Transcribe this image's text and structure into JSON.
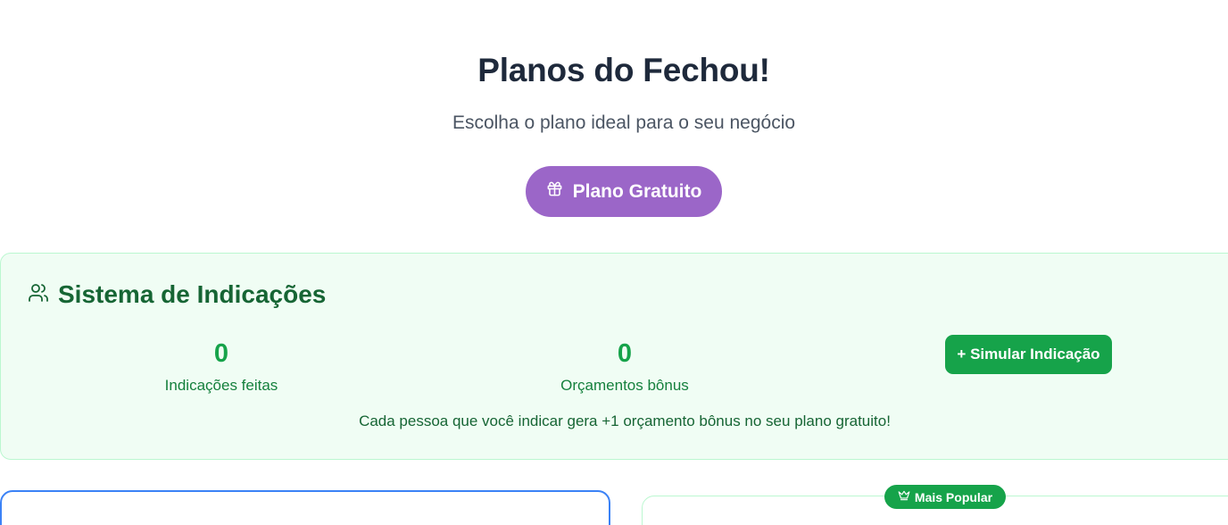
{
  "header": {
    "title": "Planos do Fechou!",
    "subtitle": "Escolha o plano ideal para o seu negócio",
    "plan_pill": {
      "label": "Plano Gratuito",
      "icon": "gift-icon",
      "color": "#9b66c8"
    }
  },
  "referral": {
    "title": "Sistema de Indicações",
    "icon": "users-icon",
    "stats": [
      {
        "value": "0",
        "label": "Indicações feitas"
      },
      {
        "value": "0",
        "label": "Orçamentos bônus"
      }
    ],
    "simulate_button": "+ Simular Indicação",
    "note": "Cada pessoa que você indicar gera +1 orçamento bônus no seu plano gratuito!",
    "accent": "#16a34a"
  },
  "plans": {
    "popular_badge": {
      "label": "Mais Popular",
      "icon": "crown-icon"
    }
  }
}
